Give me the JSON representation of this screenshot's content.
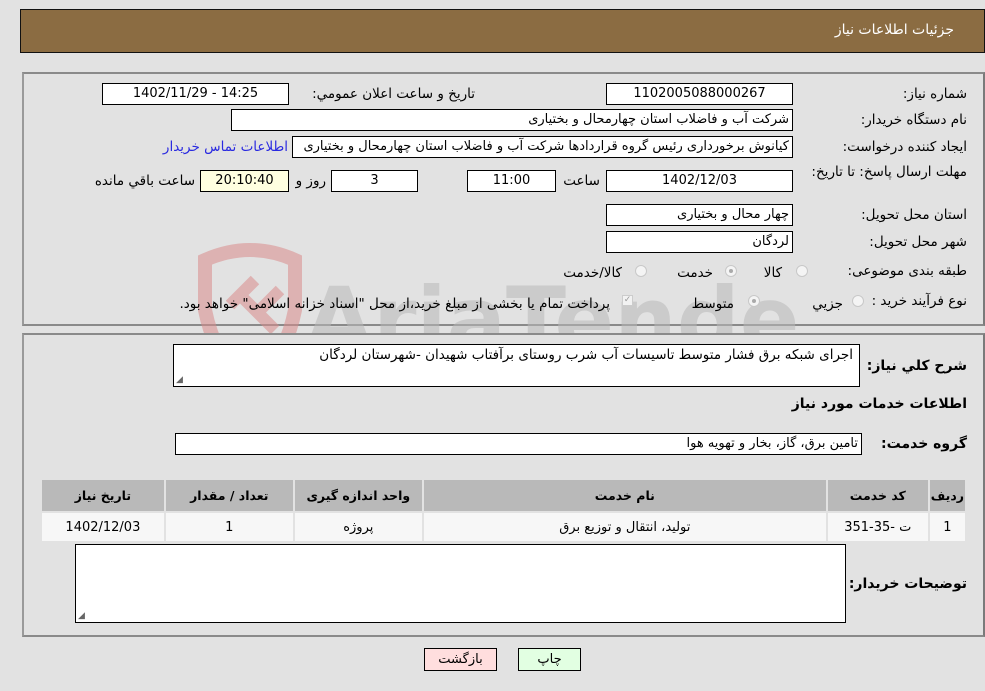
{
  "header": {
    "title": "جزئيات اطلاعات نياز"
  },
  "fields": {
    "need_number": {
      "label": "شماره نياز:",
      "value": "1102005088000267"
    },
    "announce_datetime": {
      "label": "تاريخ و ساعت اعلان عمومي:",
      "value": "1402/11/29 - 14:25"
    },
    "buyer_org": {
      "label": "نام دستگاه خريدار:",
      "value": "شرکت آب و فاضلاب استان چهارمحال و بختیاری"
    },
    "requester": {
      "label": "ايجاد کننده درخواست:",
      "value": "کیانوش برخورداری رئیس گروه قراردادها شرکت آب و فاضلاب استان چهارمحال و بختیاری"
    },
    "contact_link": "اطلاعات تماس خريدار",
    "deadline": {
      "label": "مهلت ارسال پاسخ: تا تاريخ:",
      "date": "1402/12/03",
      "time_label": "ساعت",
      "time": "11:00",
      "days": "3",
      "days_label": "روز و",
      "remaining": "20:10:40",
      "remaining_label": "ساعت باقي مانده"
    },
    "province": {
      "label": "استان محل تحويل:",
      "value": "چهار محال و بختیاری"
    },
    "city": {
      "label": "شهر محل تحويل:",
      "value": "لردگان"
    },
    "category": {
      "label": "طبقه بندی موضوعی:",
      "options": [
        {
          "label": "کالا",
          "checked": false
        },
        {
          "label": "خدمت",
          "checked": true
        },
        {
          "label": "کالا/خدمت",
          "checked": false
        }
      ]
    },
    "purchase_type": {
      "label": "نوع فرآيند خريد :",
      "options": [
        {
          "label": "جزيي",
          "checked": false
        },
        {
          "label": "متوسط",
          "checked": true
        }
      ],
      "treasury_note": "پرداخت تمام يا بخشی از مبلغ خريد،از محل \"اسناد خزانه اسلامی\" خواهد بود.",
      "treasury_checked": true
    }
  },
  "description": {
    "label": "شرح کلي نياز:",
    "value": "اجرای شبکه برق فشار متوسط تاسیسات آب شرب روستای برآفتاب شهیدان -شهرستان لردگان"
  },
  "services": {
    "section_title": "اطلاعات خدمات مورد نياز",
    "group_label": "گروه خدمت:",
    "group_value": "تامين برق، گاز، بخار و تهويه هوا",
    "table": {
      "headers": [
        "رديف",
        "کد خدمت",
        "نام خدمت",
        "واحد اندازه گيری",
        "تعداد / مقدار",
        "تاريخ نياز"
      ],
      "rows": [
        [
          "1",
          "ت -35-351",
          "توليد، انتقال و توزيع برق",
          "پروژه",
          "1",
          "1402/12/03"
        ]
      ]
    }
  },
  "buyer_notes": {
    "label": "توضيحات خريدار:",
    "value": ""
  },
  "buttons": {
    "print": "چاپ",
    "back": "بازگشت"
  },
  "watermark": {
    "text": "AriaTender.neT"
  }
}
